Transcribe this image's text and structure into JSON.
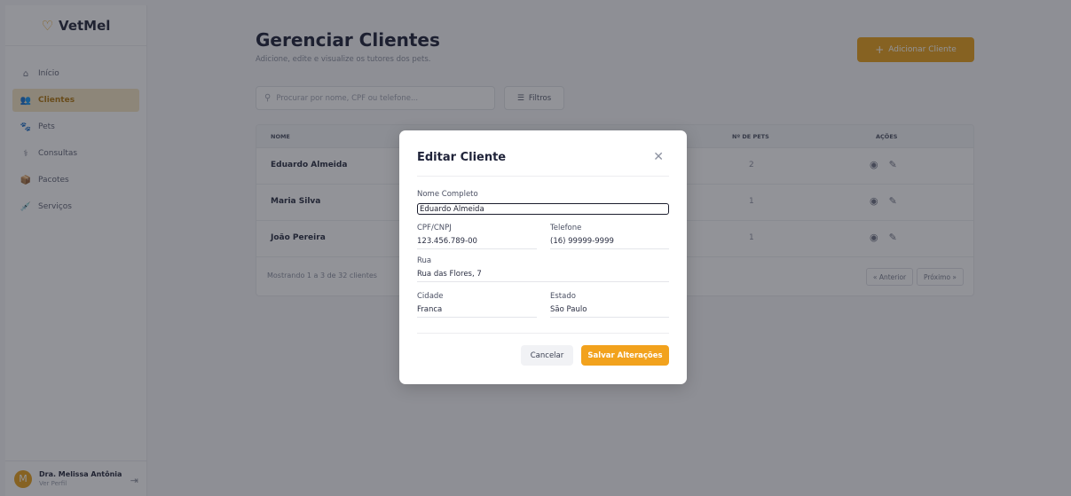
{
  "brand": {
    "name": "VetMel",
    "icon": "heart-icon"
  },
  "sidebar": {
    "items": [
      {
        "label": "Início",
        "icon": "home-icon"
      },
      {
        "label": "Clientes",
        "icon": "users-icon",
        "active": true
      },
      {
        "label": "Pets",
        "icon": "paw-icon"
      },
      {
        "label": "Consultas",
        "icon": "stethoscope-icon"
      },
      {
        "label": "Pacotes",
        "icon": "package-icon"
      },
      {
        "label": "Serviços",
        "icon": "syringe-icon"
      }
    ]
  },
  "user": {
    "initial": "M",
    "name": "Dra. Melissa Antônia",
    "link": "Ver Perfil"
  },
  "main": {
    "title": "Gerenciar Clientes",
    "subtitle": "Adicione, edite e visualize os tutores dos pets.",
    "add_button": "Adicionar Cliente",
    "search_placeholder": "Procurar por nome, CPF ou telefone...",
    "filters_label": "Filtros"
  },
  "table": {
    "headers": {
      "name": "NOME",
      "pets": "Nº DE PETS",
      "actions": "AÇÕES"
    },
    "rows": [
      {
        "name": "Eduardo Almeida",
        "pets": "2"
      },
      {
        "name": "Maria Silva",
        "pets": "1"
      },
      {
        "name": "João Pereira",
        "pets": "1"
      }
    ],
    "footer": "Mostrando 1 a 3 de 32 clientes",
    "prev": "« Anterior",
    "next": "Próximo »"
  },
  "modal": {
    "title": "Editar Cliente",
    "fields": {
      "name_label": "Nome Completo",
      "name_value": "Eduardo Almeida",
      "cpf_label": "CPF/CNPJ",
      "cpf_value": "123.456.789-00",
      "phone_label": "Telefone",
      "phone_value": "(16) 99999-9999",
      "street_label": "Rua",
      "street_value": "Rua das Flores, 7",
      "city_label": "Cidade",
      "city_value": "Franca",
      "state_label": "Estado",
      "state_value": "São Paulo"
    },
    "cancel": "Cancelar",
    "save": "Salvar Alterações"
  },
  "colors": {
    "accent": "#e8a21d",
    "active_bg": "#f6e7c4"
  }
}
